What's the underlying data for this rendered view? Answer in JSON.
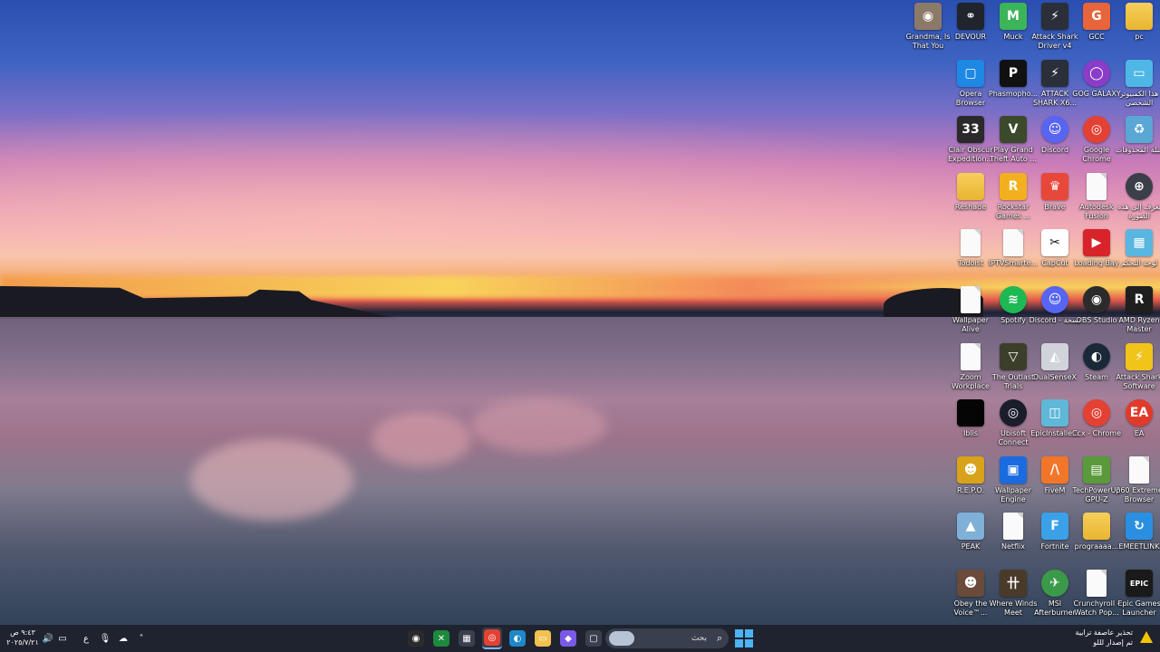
{
  "desktop": {
    "icons": [
      {
        "label": "pc",
        "glyph": "",
        "kind": "folder",
        "color": "#f2c14e",
        "col": 0,
        "row": 0
      },
      {
        "label": "GCC",
        "glyph": "G",
        "kind": "app",
        "color": "#e8643a",
        "col": 1,
        "row": 0
      },
      {
        "label": "Attack Shark Driver v4",
        "glyph": "⚡",
        "kind": "app",
        "color": "#2a2f3a",
        "col": 2,
        "row": 0
      },
      {
        "label": "Muck",
        "glyph": "M",
        "kind": "app",
        "color": "#3cb45a",
        "col": 3,
        "row": 0
      },
      {
        "label": "DEVOUR",
        "glyph": "⚭",
        "kind": "app",
        "color": "#20242c",
        "col": 4,
        "row": 0
      },
      {
        "label": "Grandma, Is That You",
        "glyph": "◉",
        "kind": "app",
        "color": "#8c7a68",
        "col": 5,
        "row": 0
      },
      {
        "label": "هذا الكمبيوتر الشخصي",
        "glyph": "▭",
        "kind": "app",
        "color": "#4fb7e6",
        "col": 0,
        "row": 1
      },
      {
        "label": "GOG GALAXY",
        "glyph": "◯",
        "kind": "round",
        "color": "#8b3cc8",
        "col": 1,
        "row": 1
      },
      {
        "label": "ATTACK SHARK X6...",
        "glyph": "⚡",
        "kind": "app",
        "color": "#2a2f3a",
        "col": 2,
        "row": 1
      },
      {
        "label": "Phasmopho...",
        "glyph": "P",
        "kind": "app",
        "color": "#111111",
        "col": 3,
        "row": 1
      },
      {
        "label": "Opera Browser",
        "glyph": "▢",
        "kind": "app",
        "color": "#1e88e5",
        "col": 4,
        "row": 1
      },
      {
        "label": "سلة المحذوفات",
        "glyph": "♻",
        "kind": "app",
        "color": "#5aa7d6",
        "col": 0,
        "row": 2
      },
      {
        "label": "Google Chrome",
        "glyph": "◎",
        "kind": "round",
        "color": "#e34133",
        "col": 1,
        "row": 2
      },
      {
        "label": "Discord",
        "glyph": "☺",
        "kind": "round",
        "color": "#5865f2",
        "col": 2,
        "row": 2
      },
      {
        "label": "Play Grand Theft Auto ...",
        "glyph": "V",
        "kind": "app",
        "color": "#3b4a2a",
        "col": 3,
        "row": 2
      },
      {
        "label": "Clair Obscur Expedition...",
        "glyph": "33",
        "kind": "app",
        "color": "#2a2a2a",
        "col": 4,
        "row": 2
      },
      {
        "label": "تعرف إلى هذه الصورة",
        "glyph": "⊕",
        "kind": "round",
        "color": "#3a3f4a",
        "col": 0,
        "row": 3
      },
      {
        "label": "Autodesk Fusion",
        "glyph": "",
        "kind": "doc",
        "color": "#fafafa",
        "col": 1,
        "row": 3
      },
      {
        "label": "Brave",
        "glyph": "♛",
        "kind": "app",
        "color": "#e8483a",
        "col": 2,
        "row": 3
      },
      {
        "label": "Rockstar Games ...",
        "glyph": "R",
        "kind": "app",
        "color": "#f2b01e",
        "col": 3,
        "row": 3
      },
      {
        "label": "Reshade",
        "glyph": "",
        "kind": "folder",
        "color": "#f2c14e",
        "col": 4,
        "row": 3
      },
      {
        "label": "لوحة التحكم",
        "glyph": "▦",
        "kind": "app",
        "color": "#58b6e0",
        "col": 0,
        "row": 4
      },
      {
        "label": "Loading Bay",
        "glyph": "▶",
        "kind": "app",
        "color": "#d8232a",
        "col": 1,
        "row": 4
      },
      {
        "label": "CapCut",
        "glyph": "✂",
        "kind": "app",
        "color": "#ffffff",
        "col": 2,
        "row": 4
      },
      {
        "label": "IPTVSmarte...",
        "glyph": "",
        "kind": "doc",
        "color": "#fafafa",
        "col": 3,
        "row": 4
      },
      {
        "label": "Todoist",
        "glyph": "",
        "kind": "doc",
        "color": "#fafafa",
        "col": 4,
        "row": 4
      },
      {
        "label": "AMD Ryzen Master",
        "glyph": "R",
        "kind": "app",
        "color": "#1f1f1f",
        "col": 0,
        "row": 5
      },
      {
        "label": "OBS Studio",
        "glyph": "◉",
        "kind": "round",
        "color": "#2b2b2b",
        "col": 1,
        "row": 5
      },
      {
        "label": "Discord - نسخة",
        "glyph": "☺",
        "kind": "round",
        "color": "#5865f2",
        "col": 2,
        "row": 5
      },
      {
        "label": "Spotify",
        "glyph": "≋",
        "kind": "round",
        "color": "#1db954",
        "col": 3,
        "row": 5
      },
      {
        "label": "Wallpaper Alive",
        "glyph": "",
        "kind": "doc",
        "color": "#fafafa",
        "col": 4,
        "row": 5
      },
      {
        "label": "Attack Shark Software",
        "glyph": "⚡",
        "kind": "app",
        "color": "#f0c419",
        "col": 0,
        "row": 6
      },
      {
        "label": "Steam",
        "glyph": "◐",
        "kind": "round",
        "color": "#1b2838",
        "col": 1,
        "row": 6
      },
      {
        "label": "DualSenseX",
        "glyph": "◭",
        "kind": "app",
        "color": "#d0d4da",
        "col": 2,
        "row": 6
      },
      {
        "label": "The Outlast Trials",
        "glyph": "▽",
        "kind": "app",
        "color": "#3b3f2a",
        "col": 3,
        "row": 6
      },
      {
        "label": "Zoom Workplace",
        "glyph": "",
        "kind": "doc",
        "color": "#fafafa",
        "col": 4,
        "row": 6
      },
      {
        "label": "EA",
        "glyph": "EA",
        "kind": "round",
        "color": "#e03a2a",
        "col": 0,
        "row": 7
      },
      {
        "label": "Ccx - Chrome",
        "glyph": "◎",
        "kind": "round",
        "color": "#e34133",
        "col": 1,
        "row": 7
      },
      {
        "label": "EpicInstalle...",
        "glyph": "◫",
        "kind": "app",
        "color": "#5fb8d8",
        "col": 2,
        "row": 7
      },
      {
        "label": "Ubisoft Connect",
        "glyph": "◎",
        "kind": "round",
        "color": "#1a1d2a",
        "col": 3,
        "row": 7
      },
      {
        "label": "Iblis",
        "glyph": "",
        "kind": "app",
        "color": "#050505",
        "col": 4,
        "row": 7
      },
      {
        "label": "360 Extreme Browser",
        "glyph": "",
        "kind": "doc",
        "color": "#fafafa",
        "col": 0,
        "row": 8
      },
      {
        "label": "TechPowerUp GPU-Z",
        "glyph": "▤",
        "kind": "app",
        "color": "#5a9a3a",
        "col": 1,
        "row": 8
      },
      {
        "label": "FiveM",
        "glyph": "/\\",
        "kind": "app",
        "color": "#f2762a",
        "col": 2,
        "row": 8
      },
      {
        "label": "Wallpaper Engine",
        "glyph": "▣",
        "kind": "app",
        "color": "#1a6be0",
        "col": 3,
        "row": 8
      },
      {
        "label": "R.E.P.O.",
        "glyph": "☻",
        "kind": "app",
        "color": "#d8a21a",
        "col": 4,
        "row": 8
      },
      {
        "label": "EMEETLINK",
        "glyph": "↻",
        "kind": "app",
        "color": "#2a8fe0",
        "col": 0,
        "row": 9
      },
      {
        "label": "prograaaa...",
        "glyph": "",
        "kind": "folder",
        "color": "#f2c14e",
        "col": 1,
        "row": 9
      },
      {
        "label": "Fortnite",
        "glyph": "F",
        "kind": "app",
        "color": "#3aa0e8",
        "col": 2,
        "row": 9
      },
      {
        "label": "Netflix",
        "glyph": "",
        "kind": "doc",
        "color": "#fafafa",
        "col": 3,
        "row": 9
      },
      {
        "label": "PEAK",
        "glyph": "▲",
        "kind": "app",
        "color": "#7fb0d8",
        "col": 4,
        "row": 9
      },
      {
        "label": "Epic Games Launcher",
        "glyph": "EPIC",
        "kind": "app",
        "color": "#1a1a1a",
        "col": 0,
        "row": 10
      },
      {
        "label": "Crunchyroll - Watch Pop...",
        "glyph": "",
        "kind": "doc",
        "color": "#fafafa",
        "col": 1,
        "row": 10
      },
      {
        "label": "MSI Afterburner",
        "glyph": "✈",
        "kind": "round",
        "color": "#3a9a4a",
        "col": 2,
        "row": 10
      },
      {
        "label": "Where Winds Meet",
        "glyph": "卄",
        "kind": "app",
        "color": "#4a3a2a",
        "col": 3,
        "row": 10
      },
      {
        "label": "Obey the Voice™...",
        "glyph": "☻",
        "kind": "app",
        "color": "#6a4a3a",
        "col": 4,
        "row": 10
      }
    ]
  },
  "taskbar": {
    "clock_time": "٩:٤٣ ص",
    "clock_date": "٢٠٢٥/٧/٢١",
    "search_placeholder": "بحث",
    "weather_line1": "تحذير عاصفة ترابية",
    "weather_line2": "تم إصدار لللو",
    "lang": "ع",
    "tray_icons": [
      "speaker-icon",
      "display-icon",
      "onedrive-icon",
      "chevron-up-icon",
      "mic-icon"
    ],
    "apps": [
      {
        "name": "obs",
        "glyph": "◉",
        "color": "#2b2b2b"
      },
      {
        "name": "xbox",
        "glyph": "✕",
        "color": "#1c8a3a"
      },
      {
        "name": "store",
        "glyph": "▦",
        "color": "#3a3f4d"
      },
      {
        "name": "chrome",
        "glyph": "◎",
        "color": "#e34133",
        "active": true
      },
      {
        "name": "edge",
        "glyph": "◐",
        "color": "#1e88c8"
      },
      {
        "name": "explorer",
        "glyph": "▭",
        "color": "#f2c14e"
      },
      {
        "name": "copilot",
        "glyph": "◆",
        "color": "#7a5ae8"
      },
      {
        "name": "task-view",
        "glyph": "▢",
        "color": "#3a3f4d"
      }
    ]
  }
}
